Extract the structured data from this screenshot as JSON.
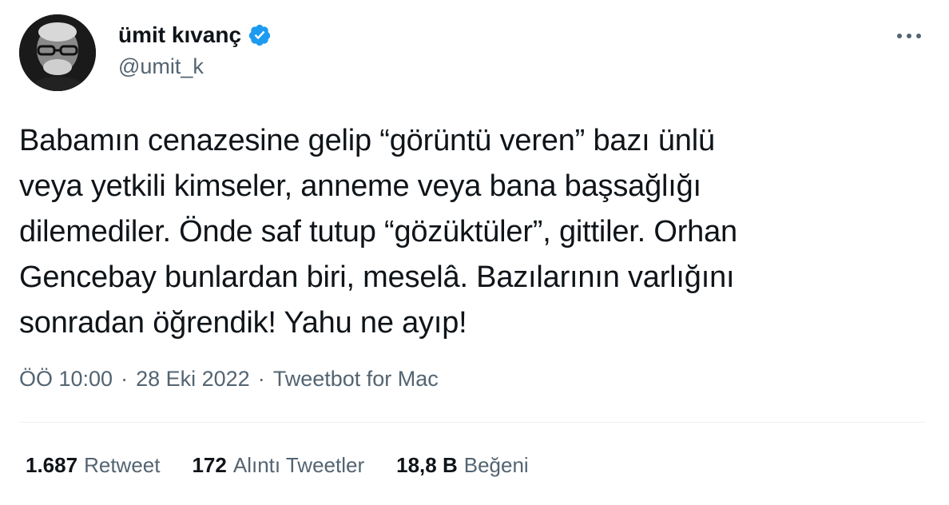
{
  "author": {
    "display_name": "ümit kıvanç",
    "handle": "@umit_k",
    "verified": true
  },
  "tweet": {
    "lines": [
      "Babamın cenazesine gelip “görüntü veren” bazı ünlü",
      "veya yetkili kimseler, anneme veya bana başsağlığı",
      "dilemediler. Önde saf tutup “gözüktüler”, gittiler. Orhan",
      "Gencebay bunlardan biri, meselâ. Bazılarının varlığını",
      "sonradan öğrendik! Yahu ne ayıp!"
    ]
  },
  "meta": {
    "time": "ÖÖ 10:00",
    "separator": "·",
    "date": "28 Eki 2022",
    "source": "Tweetbot for Mac"
  },
  "stats": {
    "retweets": {
      "count": "1.687",
      "label": "Retweet"
    },
    "quotes": {
      "count": "172",
      "label": "Alıntı Tweetler"
    },
    "likes": {
      "count": "18,8 B",
      "label": "Beğeni"
    }
  },
  "icons": {
    "verified": "verified-badge-icon",
    "more": "more-options-icon"
  },
  "colors": {
    "text": "#0f1419",
    "secondary": "#536471",
    "verified": "#1d9bf0",
    "divider": "#eff3f4"
  }
}
